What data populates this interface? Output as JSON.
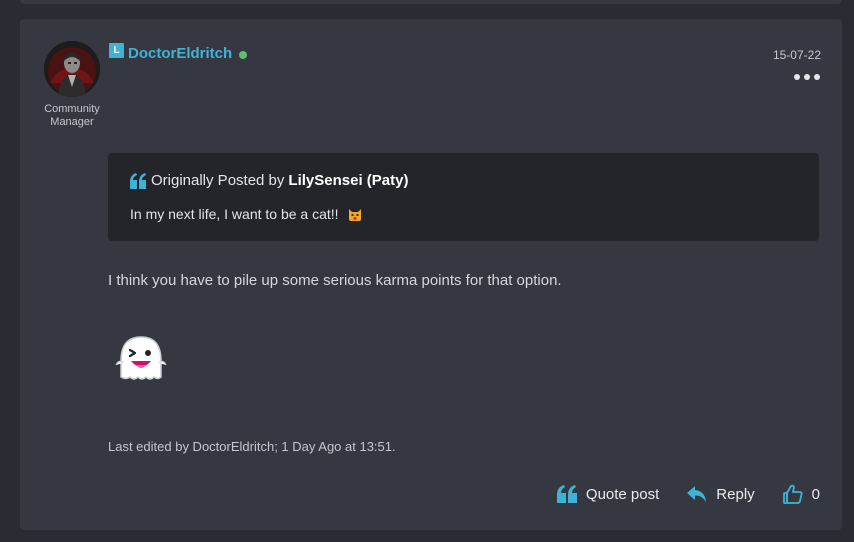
{
  "post": {
    "author": "DoctorEldritch",
    "author_badge": "L",
    "role": "Community Manager",
    "date": "15-07-22",
    "quote": {
      "prefix": "Originally Posted by",
      "author": "LilySensei (Paty)",
      "text": "In my next life, I want to be a cat!!",
      "emoji": "cat-emoji"
    },
    "message": "I think you have to pile up some serious karma points for that option.",
    "sticker": "ghost-emoji",
    "edited": "Last edited by DoctorEldritch; 1 Day Ago at 13:51."
  },
  "actions": {
    "quote_label": "Quote post",
    "reply_label": "Reply",
    "like_count": "0"
  },
  "colors": {
    "page_bg": "#2b2c33",
    "post_bg": "#363841",
    "quote_bg": "#24252b",
    "accent": "#3fb3d6",
    "online": "#5cc26a"
  }
}
